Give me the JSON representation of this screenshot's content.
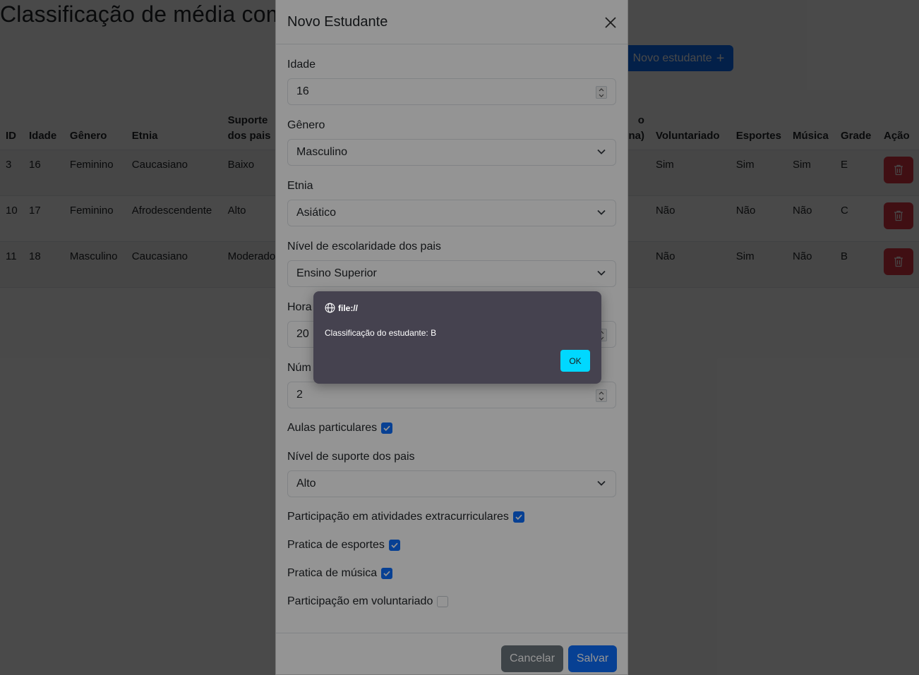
{
  "page": {
    "title": "Classificação de média com base em dados de estudantes",
    "new_button_label": "Novo estudante",
    "new_button_icon": "plus-icon"
  },
  "table": {
    "headers": [
      "ID",
      "Idade",
      "Gênero",
      "Etnia",
      "Suporte dos pais",
      "",
      "",
      "",
      "Voluntariado",
      "Esportes",
      "Música",
      "Grade",
      "Ação"
    ],
    "header_suporte_line1": "Suporte",
    "header_suporte_line2": "dos pais",
    "header_hidden_line1": "o",
    "header_hidden_line2": "na)",
    "rows": [
      {
        "id": "3",
        "idade": "16",
        "genero": "Feminino",
        "etnia": "Caucasiano",
        "suporte": "Baixo",
        "voluntariado": "Sim",
        "esportes": "Sim",
        "musica": "Sim",
        "grade": "E"
      },
      {
        "id": "10",
        "idade": "17",
        "genero": "Feminino",
        "etnia": "Afrodescendente",
        "suporte": "Alto",
        "voluntariado": "Não",
        "esportes": "Não",
        "musica": "Não",
        "grade": "C"
      },
      {
        "id": "11",
        "idade": "18",
        "genero": "Masculino",
        "etnia": "Caucasiano",
        "suporte": "Moderado",
        "voluntariado": "Não",
        "esportes": "Sim",
        "musica": "Não",
        "grade": "B"
      }
    ],
    "delete_icon": "trash-icon"
  },
  "modal": {
    "title": "Novo Estudante",
    "close_icon": "close-icon",
    "fields": {
      "idade": {
        "label": "Idade",
        "value": "16"
      },
      "genero": {
        "label": "Gênero",
        "value": "Masculino"
      },
      "etnia": {
        "label": "Etnia",
        "value": "Asiático"
      },
      "escolaridade": {
        "label": "Nível de escolaridade dos pais",
        "value": "Ensino Superior"
      },
      "horas": {
        "label": "Hora",
        "value": "20"
      },
      "numero": {
        "label": "Núm",
        "value": "2"
      },
      "aulas": {
        "label": "Aulas particulares",
        "checked": true
      },
      "suporte": {
        "label": "Nível de suporte dos pais",
        "value": "Alto"
      },
      "extracurriculares": {
        "label": "Participação em atividades extracurriculares",
        "checked": true
      },
      "esportes": {
        "label": "Pratica de esportes",
        "checked": true
      },
      "musica": {
        "label": "Pratica de música",
        "checked": true
      },
      "voluntariado": {
        "label": "Participação em voluntariado",
        "checked": false
      }
    },
    "cancel_label": "Cancelar",
    "save_label": "Salvar"
  },
  "alert": {
    "origin": "file://",
    "origin_icon": "globe-icon",
    "message": "Classificação do estudante: B",
    "ok_label": "OK"
  },
  "colors": {
    "primary": "#0d6efd",
    "danger": "#dc3545",
    "secondary": "#6c757d",
    "alert_bg": "#45424f",
    "alert_ok": "#00d8ff"
  }
}
